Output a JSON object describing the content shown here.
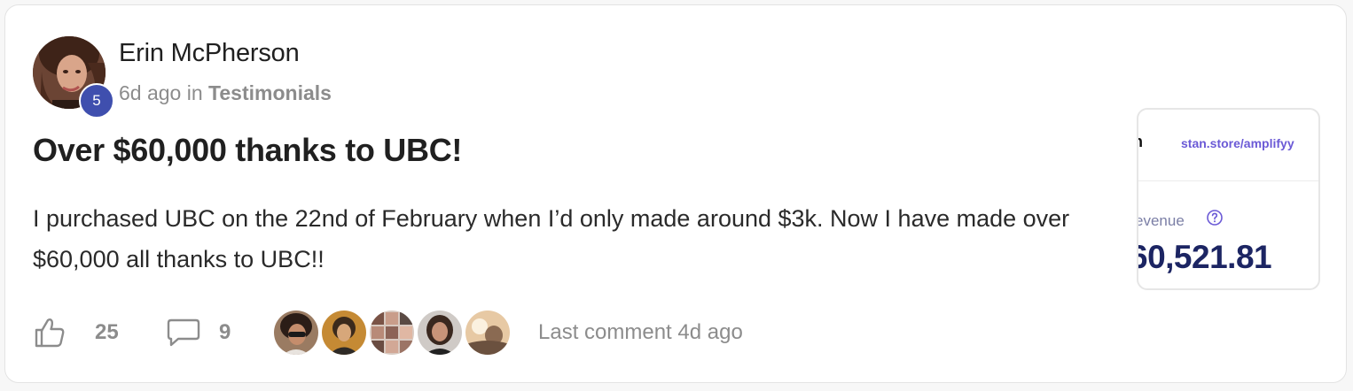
{
  "post": {
    "author": "Erin McPherson",
    "level": "5",
    "time_ago": "6d ago",
    "in_label": "in",
    "category": "Testimonials",
    "title": "Over $60,000 thanks to UBC!",
    "body": "I purchased UBC on the 22nd of February when I’d only made around $3k. Now I have made over $60,000 all thanks to UBC!!"
  },
  "footer": {
    "like_icon": "thumbs-up-icon",
    "likes": "25",
    "comment_icon": "comment-bubble-icon",
    "comments": "9",
    "commenter_count": 5,
    "last_comment": "Last comment 4d ago"
  },
  "preview": {
    "cut_letter": "n",
    "store_url": "stan.store/amplifyy",
    "revenue_label": "evenue",
    "revenue_value": "60,521.81"
  },
  "colors": {
    "badge": "#3f4fae",
    "store_url": "#6b5ad6",
    "revenue_value": "#1c2563",
    "muted_text": "#8c8c8c"
  }
}
